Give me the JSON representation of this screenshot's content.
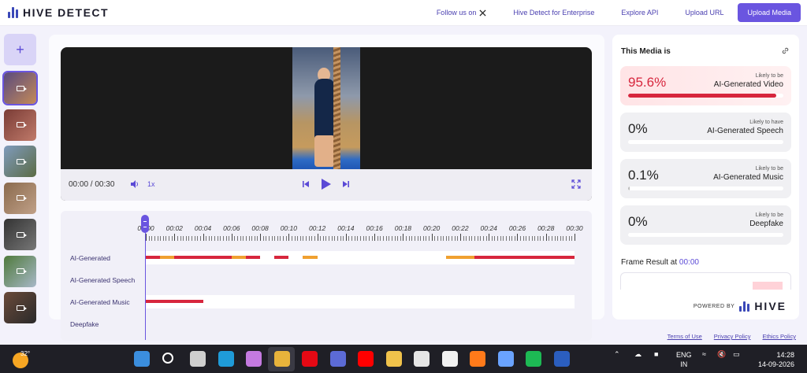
{
  "header": {
    "logo_text": "HIVE DETECT",
    "nav": {
      "follow_label": "Follow us on",
      "follow_icon": "x-logo-icon",
      "enterprise_label": "Hive Detect for Enterprise",
      "api_label": "Explore API",
      "upload_url_label": "Upload URL",
      "upload_media_label": "Upload Media"
    }
  },
  "sidebar": {
    "add_label": "+",
    "thumbnails": [
      {
        "colors": [
          "#5a4a7e",
          "#c48a58"
        ],
        "selected": true
      },
      {
        "colors": [
          "#7a3c36",
          "#c07a6a"
        ],
        "selected": false
      },
      {
        "colors": [
          "#7f9bbd",
          "#5b6b45"
        ],
        "selected": false
      },
      {
        "colors": [
          "#8a6a4d",
          "#c0a088"
        ],
        "selected": false
      },
      {
        "colors": [
          "#333333",
          "#777777"
        ],
        "selected": false
      },
      {
        "colors": [
          "#4f7a3c",
          "#a8b8c8"
        ],
        "selected": false
      },
      {
        "colors": [
          "#6a4a3a",
          "#2a2a2a"
        ],
        "selected": false
      }
    ]
  },
  "player": {
    "time": "00:00 / 00:30",
    "speed": "1x"
  },
  "timeline": {
    "ticks": [
      "00:00",
      "00:02",
      "00:04",
      "00:06",
      "00:08",
      "00:10",
      "00:12",
      "00:14",
      "00:16",
      "00:18",
      "00:20",
      "00:22",
      "00:24",
      "00:26",
      "00:28",
      "00:30"
    ],
    "rows": [
      {
        "label": "AI-Generated",
        "segments": [
          {
            "start": 0.0,
            "end": 1.0,
            "color": "#d7263d"
          },
          {
            "start": 1.0,
            "end": 2.0,
            "color": "#f0a030"
          },
          {
            "start": 2.0,
            "end": 6.0,
            "color": "#d7263d"
          },
          {
            "start": 6.0,
            "end": 7.0,
            "color": "#f0a030"
          },
          {
            "start": 7.0,
            "end": 8.0,
            "color": "#d7263d"
          },
          {
            "start": 9.0,
            "end": 10.0,
            "color": "#d7263d"
          },
          {
            "start": 11.0,
            "end": 12.0,
            "color": "#f0a030"
          },
          {
            "start": 21.0,
            "end": 23.0,
            "color": "#f0a030"
          },
          {
            "start": 23.0,
            "end": 30.0,
            "color": "#d7263d"
          }
        ]
      },
      {
        "label": "AI-Generated Speech",
        "segments": []
      },
      {
        "label": "AI-Generated Music",
        "segments": [
          {
            "start": 0.0,
            "end": 4.0,
            "color": "#d7263d"
          }
        ]
      },
      {
        "label": "Deepfake",
        "segments": []
      }
    ]
  },
  "result": {
    "title": "This Media is",
    "cards": [
      {
        "percent": "95.6%",
        "value": 0.956,
        "likely": "Likely to be",
        "class": "AI-Generated Video",
        "hot": true
      },
      {
        "percent": "0%",
        "value": 0.0,
        "likely": "Likely to have",
        "class": "AI-Generated Speech",
        "hot": false
      },
      {
        "percent": "0.1%",
        "value": 0.001,
        "likely": "Likely to be",
        "class": "AI-Generated Music",
        "hot": false
      },
      {
        "percent": "0%",
        "value": 0.0,
        "likely": "Likely to be",
        "class": "Deepfake",
        "hot": false
      }
    ],
    "frame_result_label": "Frame Result at",
    "frame_result_time": "00:00",
    "powered_by": "POWERED BY",
    "powered_brand": "HIVE"
  },
  "footer": {
    "terms": "Terms of Use",
    "privacy": "Privacy Policy",
    "ethics": "Ethics Policy"
  },
  "taskbar": {
    "temperature": "32°",
    "apps": [
      {
        "name": "windows-start-icon",
        "color": "#3b8ede"
      },
      {
        "name": "search-icon",
        "color": "#ffffff"
      },
      {
        "name": "task-view-icon",
        "color": "#cfcfcf"
      },
      {
        "name": "edge-browser-icon",
        "color": "#1f9bd8"
      },
      {
        "name": "copilot-icon",
        "color": "#c47ae0"
      },
      {
        "name": "chrome-browser-icon",
        "color": "#e8b33b"
      },
      {
        "name": "netflix-icon",
        "color": "#e50914"
      },
      {
        "name": "prime-video-icon",
        "color": "#5c6bd6"
      },
      {
        "name": "youtube-icon",
        "color": "#ff0000"
      },
      {
        "name": "file-explorer-icon",
        "color": "#f0c24b"
      },
      {
        "name": "microsoft-store-icon",
        "color": "#e6e6e6"
      },
      {
        "name": "vim-icon",
        "color": "#f2f2f2"
      },
      {
        "name": "firefox-icon",
        "color": "#ff7a1a"
      },
      {
        "name": "notepad-icon",
        "color": "#6aa3ff"
      },
      {
        "name": "spotify-icon",
        "color": "#1db954"
      },
      {
        "name": "word-icon",
        "color": "#2b5ebf"
      }
    ],
    "lang_line1": "ENG",
    "lang_line2": "IN",
    "time": "14:28",
    "date": "14-09-2026"
  }
}
